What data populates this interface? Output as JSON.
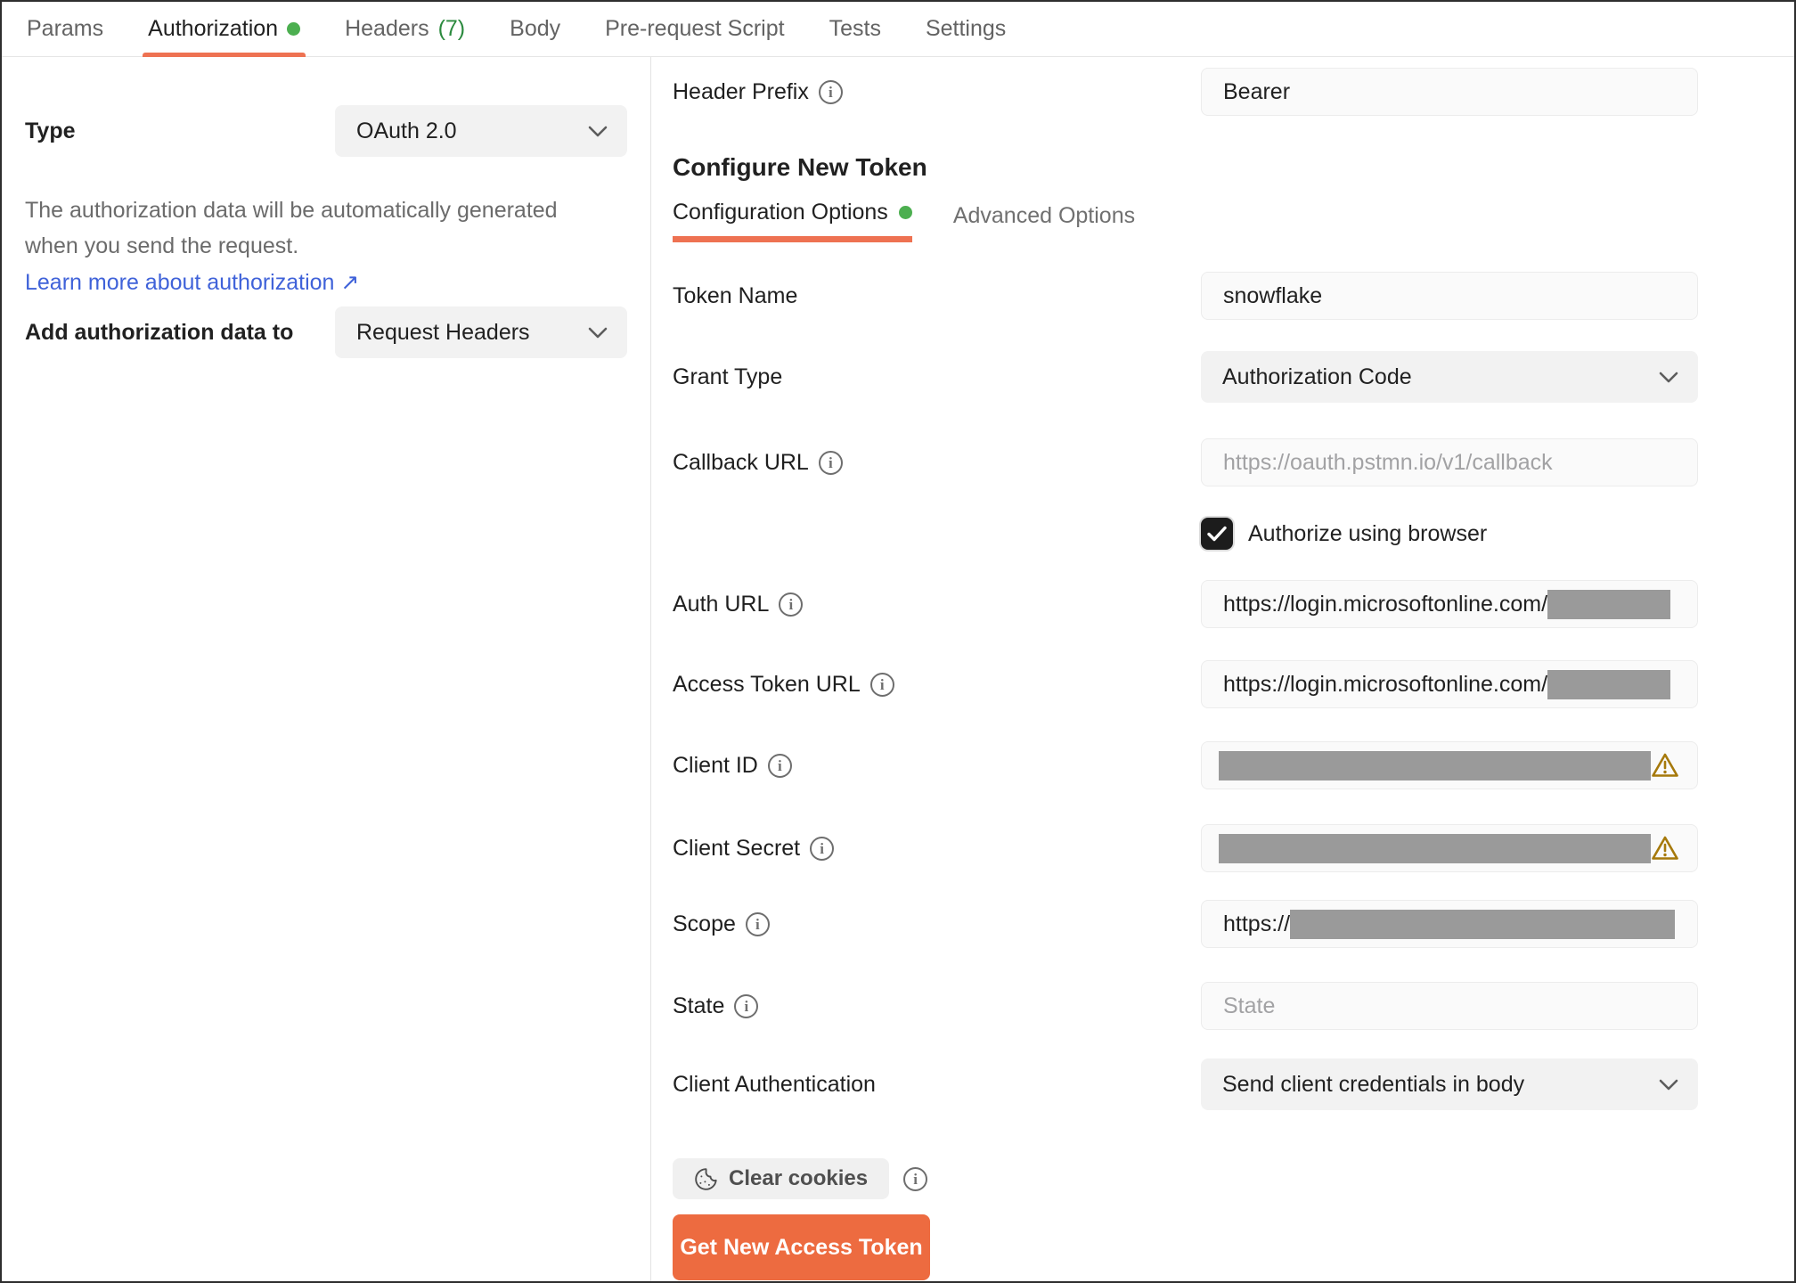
{
  "tabs": [
    {
      "label": "Params"
    },
    {
      "label": "Authorization",
      "active": true,
      "has_green_dot": true
    },
    {
      "label": "Headers",
      "count": "(7)"
    },
    {
      "label": "Body"
    },
    {
      "label": "Pre-request Script"
    },
    {
      "label": "Tests"
    },
    {
      "label": "Settings"
    }
  ],
  "left_panel": {
    "type_label": "Type",
    "type_value": "OAuth 2.0",
    "description_line1": "The authorization data will be automatically generated",
    "description_line2": "when you send the request.",
    "learn_more_link": "Learn more about authorization ↗",
    "add_auth_label": "Add authorization data to",
    "add_auth_value": "Request Headers"
  },
  "right_panel": {
    "header_prefix": {
      "label": "Header Prefix",
      "value": "Bearer",
      "has_info_icon": true
    },
    "section_heading": "Configure New Token",
    "sub_tabs": [
      {
        "label": "Configuration Options",
        "active": true,
        "has_green_dot": true
      },
      {
        "label": "Advanced Options"
      }
    ],
    "fields": {
      "token_name": {
        "label": "Token Name",
        "value": "snowflake"
      },
      "grant_type": {
        "label": "Grant Type",
        "value": "Authorization Code"
      },
      "callback_url": {
        "label": "Callback URL",
        "placeholder": "https://oauth.pstmn.io/v1/callback",
        "has_info_icon": true
      },
      "authorize_browser": {
        "label": "Authorize using browser",
        "checked": true
      },
      "auth_url": {
        "label": "Auth URL",
        "visible_value": "https://login.microsoftonline.com/",
        "redacted": true,
        "has_info_icon": true
      },
      "access_token_url": {
        "label": "Access Token URL",
        "visible_value": "https://login.microsoftonline.com/",
        "redacted": true,
        "has_info_icon": true
      },
      "client_id": {
        "label": "Client ID",
        "redacted": true,
        "warning": true,
        "has_info_icon": true
      },
      "client_secret": {
        "label": "Client Secret",
        "redacted": true,
        "warning": true,
        "has_info_icon": true
      },
      "scope": {
        "label": "Scope",
        "visible_value": "https://",
        "redacted": true,
        "has_info_icon": true
      },
      "state": {
        "label": "State",
        "placeholder": "State",
        "has_info_icon": true
      },
      "client_authentication": {
        "label": "Client Authentication",
        "value": "Send client credentials in body"
      }
    },
    "clear_cookies_button": "Clear cookies",
    "get_token_button": "Get New Access Token"
  },
  "colors": {
    "accent_orange": "#ee7252",
    "button_orange": "#ed6b40",
    "green_dot": "#4caf50",
    "count_green": "#2b8a3e",
    "link_blue": "#3f62d9",
    "redaction_gray": "#9a9a9a",
    "warning_amber": "#a6790b",
    "text_dark": "#212121",
    "text_gray": "#6b6b6b"
  }
}
